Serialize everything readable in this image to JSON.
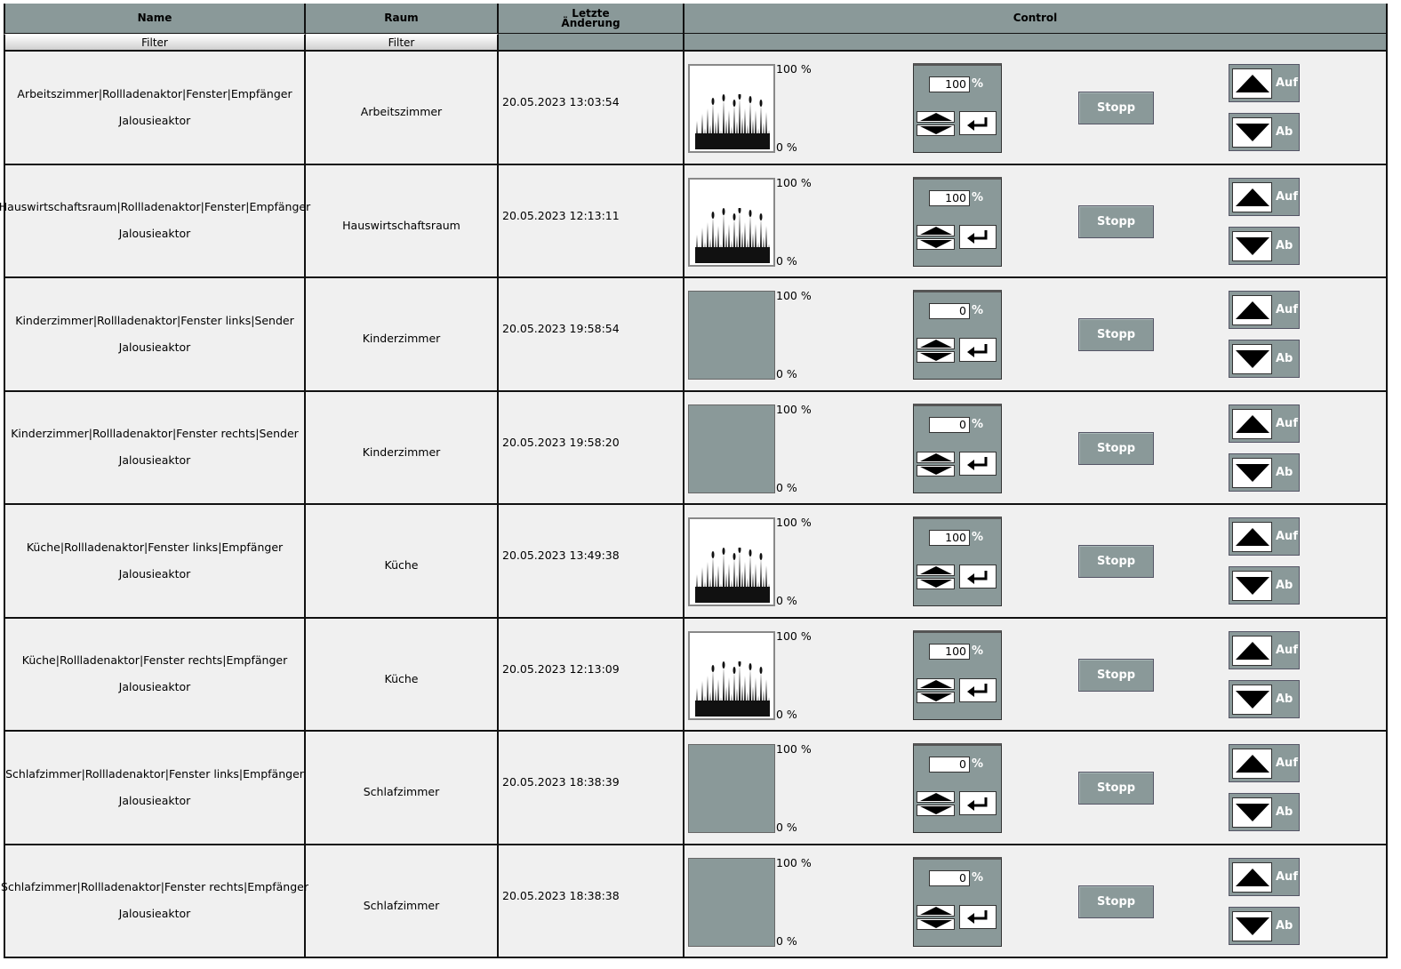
{
  "header": {
    "name": "Name",
    "room": "Raum",
    "last_change_line1": "Letzte",
    "last_change_line2": "Änderung",
    "control": "Control"
  },
  "filters": {
    "name": "Filter",
    "room": "Filter"
  },
  "labels": {
    "top": "100 %",
    "bottom": "0 %",
    "percent": "%",
    "stop": "Stopp",
    "up": "Auf",
    "down": "Ab"
  },
  "rows": [
    {
      "name": "Arbeitszimmer|Rollladenaktor|Fenster|Empfänger",
      "type": "Jalousieaktor",
      "room": "Arbeitszimmer",
      "time": "20.05.2023 13:03:54",
      "position": "100"
    },
    {
      "name": "Hauswirtschaftsraum|Rollladenaktor|Fenster|Empfänger",
      "type": "Jalousieaktor",
      "room": "Hauswirtschaftsraum",
      "time": "20.05.2023 12:13:11",
      "position": "100"
    },
    {
      "name": "Kinderzimmer|Rollladenaktor|Fenster links|Sender",
      "type": "Jalousieaktor",
      "room": "Kinderzimmer",
      "time": "20.05.2023 19:58:54",
      "position": "0"
    },
    {
      "name": "Kinderzimmer|Rollladenaktor|Fenster rechts|Sender",
      "type": "Jalousieaktor",
      "room": "Kinderzimmer",
      "time": "20.05.2023 19:58:20",
      "position": "0"
    },
    {
      "name": "Küche|Rollladenaktor|Fenster links|Empfänger",
      "type": "Jalousieaktor",
      "room": "Küche",
      "time": "20.05.2023 13:49:38",
      "position": "100"
    },
    {
      "name": "Küche|Rollladenaktor|Fenster rechts|Empfänger",
      "type": "Jalousieaktor",
      "room": "Küche",
      "time": "20.05.2023 12:13:09",
      "position": "100"
    },
    {
      "name": "Schlafzimmer|Rollladenaktor|Fenster links|Empfänger",
      "type": "Jalousieaktor",
      "room": "Schlafzimmer",
      "time": "20.05.2023 18:38:39",
      "position": "0"
    },
    {
      "name": "Schlafzimmer|Rollladenaktor|Fenster rechts|Empfänger",
      "type": "Jalousieaktor",
      "room": "Schlafzimmer",
      "time": "20.05.2023 18:38:38",
      "position": "0"
    }
  ]
}
